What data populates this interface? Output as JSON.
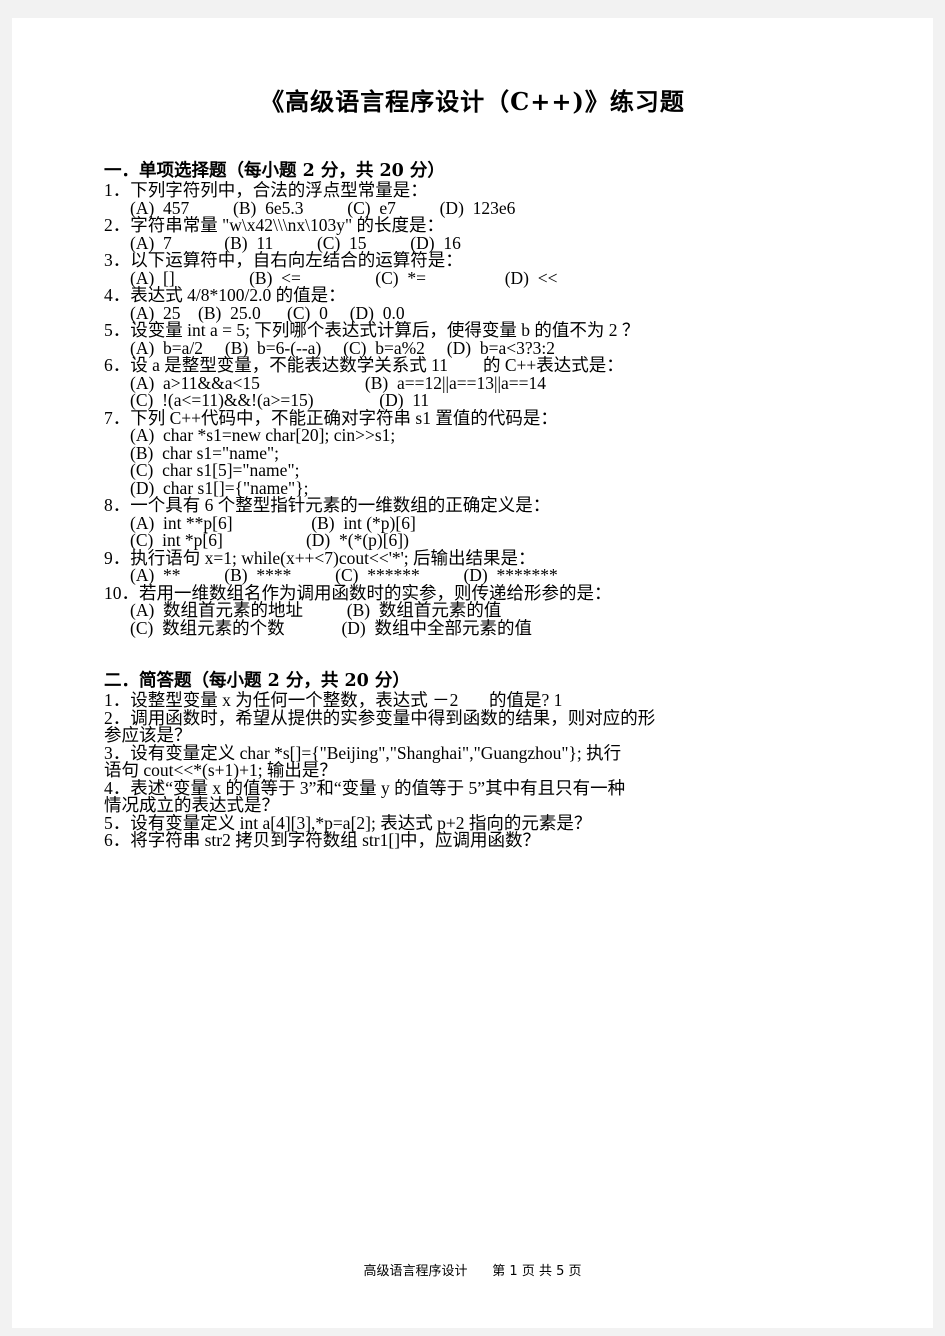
{
  "document": {
    "title": "《高级语言程序设计（C++)》练习题",
    "footer": "高级语言程序设计      第 1 页 共 5 页"
  },
  "sections": [
    {
      "heading": "一．单项选择题（每小题 2 分，共 20 分）",
      "questions": [
        {
          "number": "1．",
          "text": "下列字符列中，合法的浮点型常量是：",
          "option_rows": [
            "(A)  457          (B)  6e5.3          (C)  e7          (D)  123e6"
          ]
        },
        {
          "number": "2．",
          "text": "字符串常量 \"w\\x42\\\\\\nx\\103y\" 的长度是：",
          "option_rows": [
            "(A)  7            (B)  11          (C)  15          (D)  16"
          ]
        },
        {
          "number": "3．",
          "text": "以下运算符中，自右向左结合的运算符是：",
          "option_rows": [
            "(A)  []                 (B)  <=                 (C)  *=                  (D)  <<"
          ]
        },
        {
          "number": "4．",
          "text": "表达式 4/8*100/2.0 的值是：",
          "option_rows": [
            "(A)  25    (B)  25.0      (C)  0     (D)  0.0"
          ]
        },
        {
          "number": "5．",
          "text": "设变量 int a = 5; 下列哪个表达式计算后，使得变量 b 的值不为 2 ？",
          "option_rows": [
            "(A)  b=a/2     (B)  b=6-(--a)     (C)  b=a%2     (D)  b=a<3?3:2"
          ]
        },
        {
          "number": "6．",
          "text": "设 a 是整型变量，不能表达数学关系式 11        的 C++表达式是：",
          "option_rows": [
            "(A)  a>11&&a<15                        (B)  a==12||a==13||a==14",
            "(C)  !(a<=11)&&!(a>=15)               (D)  11"
          ]
        },
        {
          "number": "7．",
          "text": "下列 C++代码中，不能正确对字符串 s1 置值的代码是：",
          "option_rows": [
            "(A)  char *s1=new char[20]; cin>>s1;",
            "(B)  char s1=\"name\";",
            "(C)  char s1[5]=\"name\";",
            "(D)  char s1[]={\"name\"};"
          ]
        },
        {
          "number": "8．",
          "text": "一个具有 6 个整型指针元素的一维数组的正确定义是：",
          "option_rows": [
            "(A)  int **p[6]                  (B)  int (*p)[6]",
            "(C)  int *p[6]                   (D)  *(*(p)[6])"
          ]
        },
        {
          "number": "9．",
          "text": "执行语句 x=1; while(x++<7)cout<<'*'; 后输出结果是：",
          "option_rows": [
            "(A)  **          (B)  ****          (C)  ******          (D)  *******"
          ]
        },
        {
          "number": "10．",
          "text": "若用一维数组名作为调用函数时的实参，则传递给形参的是：",
          "option_rows": [
            "(A)  数组首元素的地址          (B)  数组首元素的值",
            "(C)  数组元素的个数             (D)  数组中全部元素的值"
          ]
        }
      ]
    },
    {
      "heading": "二．简答题（每小题 2 分，共 20 分）",
      "questions": [
        {
          "number": "1．",
          "text": "设整型变量 x 为任何一个整数，表达式 －2       的值是? 1",
          "option_rows": []
        },
        {
          "number": "2．",
          "text": "调用函数时，希望从提供的实参变量中得到函数的结果，则对应的形",
          "continuation": "参应该是？",
          "option_rows": []
        },
        {
          "number": "3．",
          "text": "设有变量定义 char *s[]={\"Beijing\",\"Shanghai\",\"Guangzhou\"}; 执行",
          "continuation": "语句 cout<<*(s+1)+1; 输出是？",
          "option_rows": []
        },
        {
          "number": "4．",
          "text": "表述“变量 x 的值等于 3”和“变量 y 的值等于 5”其中有且只有一种",
          "continuation": "情况成立的表达式是？",
          "option_rows": []
        },
        {
          "number": "5．",
          "text": "设有变量定义 int a[4][3],*p=a[2]; 表达式 p+2 指向的元素是？",
          "option_rows": []
        },
        {
          "number": "6．",
          "text": "将字符串 str2 拷贝到字符数组 str1[]中，应调用函数？",
          "option_rows": []
        }
      ]
    }
  ]
}
